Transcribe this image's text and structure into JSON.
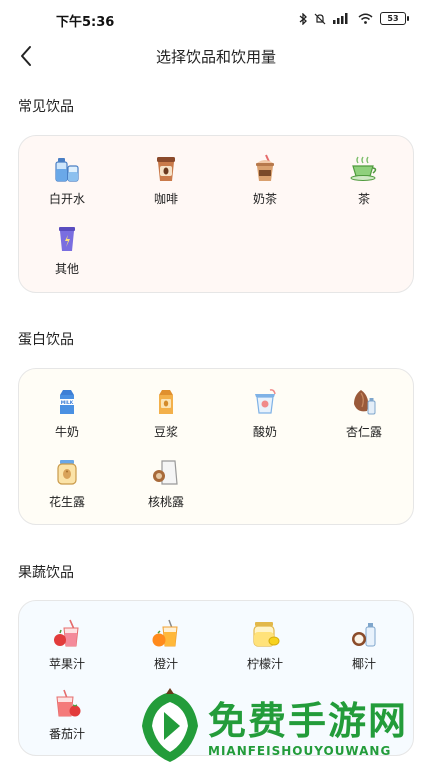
{
  "status_bar": {
    "time": "下午5:36",
    "battery": "53"
  },
  "header": {
    "title": "选择饮品和饮用量"
  },
  "sections": [
    {
      "title": "常见饮品",
      "items": [
        {
          "label": "白开水",
          "icon": "water-bottle-icon"
        },
        {
          "label": "咖啡",
          "icon": "coffee-cup-icon"
        },
        {
          "label": "奶茶",
          "icon": "milk-tea-icon"
        },
        {
          "label": "茶",
          "icon": "tea-cup-icon"
        },
        {
          "label": "其他",
          "icon": "other-drink-icon"
        }
      ]
    },
    {
      "title": "蛋白饮品",
      "items": [
        {
          "label": "牛奶",
          "icon": "milk-carton-icon"
        },
        {
          "label": "豆浆",
          "icon": "soy-milk-icon"
        },
        {
          "label": "酸奶",
          "icon": "yogurt-icon"
        },
        {
          "label": "杏仁露",
          "icon": "almond-milk-icon"
        },
        {
          "label": "花生露",
          "icon": "peanut-milk-icon"
        },
        {
          "label": "核桃露",
          "icon": "walnut-milk-icon"
        }
      ]
    },
    {
      "title": "果蔬饮品",
      "items": [
        {
          "label": "苹果汁",
          "icon": "apple-juice-icon"
        },
        {
          "label": "橙汁",
          "icon": "orange-juice-icon"
        },
        {
          "label": "柠檬汁",
          "icon": "lemon-juice-icon"
        },
        {
          "label": "椰汁",
          "icon": "coconut-juice-icon"
        },
        {
          "label": "番茄汁",
          "icon": "tomato-juice-icon"
        }
      ]
    }
  ],
  "watermark": {
    "title": "免费手游网",
    "subtitle": "MIANFEISHOUYOUWANG"
  }
}
